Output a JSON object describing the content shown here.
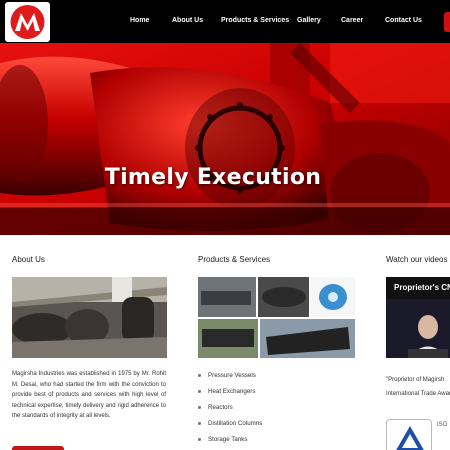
{
  "brand": {
    "logo_letter": "M",
    "accent": "#d01010"
  },
  "nav": {
    "items": [
      "Home",
      "About Us",
      "Products & Services",
      "Gallery",
      "Career",
      "Contact Us"
    ]
  },
  "hero": {
    "title": "Timely Execution",
    "slides": 4,
    "active_slide": 4
  },
  "about": {
    "title": "About Us",
    "text": "Magirsha Industries was established in 1975 by Mr. Rohit M. Desai, who had started the firm with the conviction to provide best of products and services with high level of technical expertise, timely delivery and rigid adherence to the standards of integrity at all levels."
  },
  "products": {
    "title": "Products & Services",
    "items": [
      "Pressure Vessels",
      "Heat Exchangers",
      "Reactors",
      "Distillation Columns",
      "Storage Tanks"
    ]
  },
  "videos": {
    "title": "Watch our videos",
    "video_title": "Proprietor's CN",
    "caption_line1": "\"Proprietor of Magirsh",
    "caption_line2": "International Trade Award",
    "iso_label": "ISO"
  }
}
